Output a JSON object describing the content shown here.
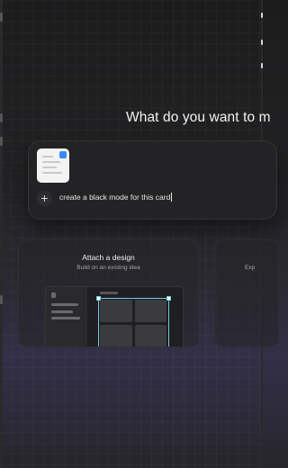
{
  "hero": {
    "headline": "What do you want to m"
  },
  "prompt": {
    "text": "create a black mode for this card",
    "add_icon": "plus-icon",
    "attachment_icon": "image-thumbnail-icon"
  },
  "options": [
    {
      "title": "Attach a design",
      "subtitle": "Build on an existing idea"
    },
    {
      "title": "",
      "subtitle": "Exp"
    }
  ],
  "colors": {
    "background": "#1c1c1d",
    "card": "#232325",
    "accent": "#77c9e0",
    "badge": "#3b8bf6"
  }
}
